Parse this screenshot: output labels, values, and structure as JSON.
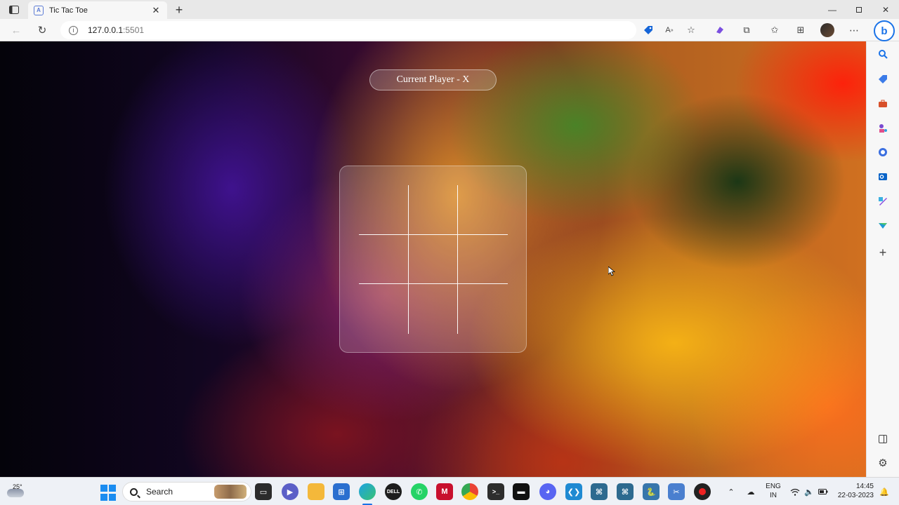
{
  "browser": {
    "tab": {
      "title": "Tic Tac Toe"
    },
    "address": {
      "host": "127.0.0.1",
      "port": ":5501"
    }
  },
  "page": {
    "status": "Current Player - X",
    "board": [
      "",
      "",
      "",
      "",
      "",
      "",
      "",
      "",
      ""
    ]
  },
  "taskbar": {
    "weather_temp": "25°",
    "search_label": "Search",
    "language_line1": "ENG",
    "language_line2": "IN",
    "time": "14:45",
    "date": "22-03-2023"
  },
  "colors": {
    "accent": "#1a73e8",
    "board_lines": "#ffffff"
  }
}
